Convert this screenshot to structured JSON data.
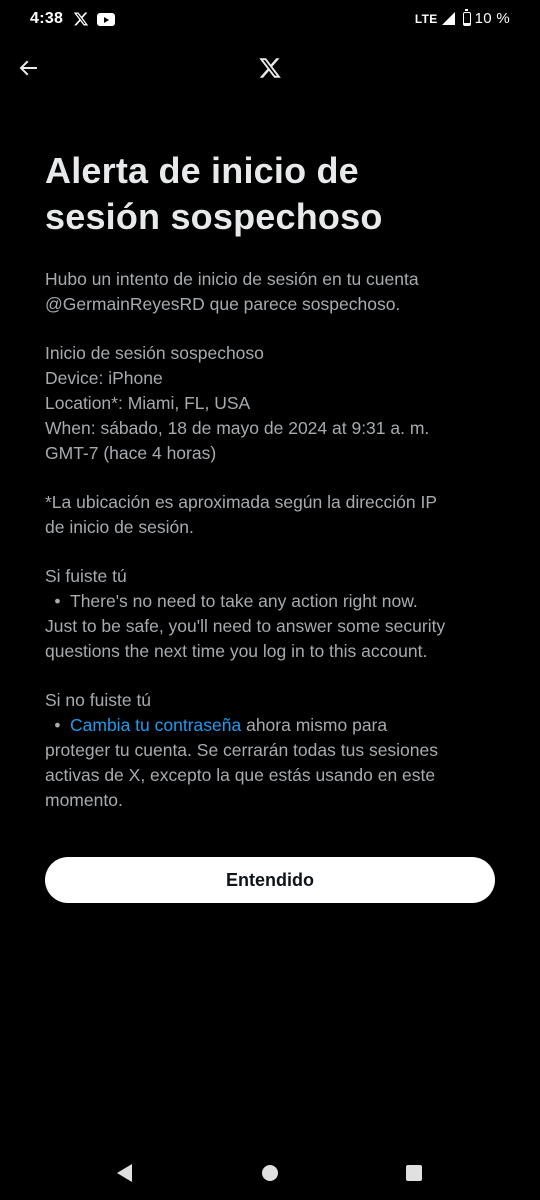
{
  "status_bar": {
    "time": "4:38",
    "network": "LTE",
    "battery_percent": "10 %",
    "battery_level": 0.1,
    "icons": [
      "x-app-icon",
      "youtube-icon",
      "signal-icon",
      "battery-icon"
    ]
  },
  "app_bar": {
    "back_icon": "arrow-left-icon",
    "logo": "x-logo-icon"
  },
  "alert": {
    "title_lines": [
      "Alerta de inicio de",
      "sesión sospechoso"
    ],
    "intro_lines": [
      "Hubo un intento de inicio de sesión en tu cuenta",
      "@GermainReyesRD que parece sospechoso."
    ],
    "details_lines": [
      "Inicio de sesión sospechoso",
      "Device: iPhone",
      "Location*: Miami, FL, USA",
      "When: sábado, 18 de mayo de 2024 at 9:31 a. m.",
      "GMT-7 (hace 4 horas)"
    ],
    "note_lines": [
      "*La ubicación es aproximada según la dirección IP",
      "de inicio de sesión."
    ],
    "if_you": {
      "heading": "Si fuiste tú",
      "bullet": "•",
      "line1": "There's no need to take any action right now.",
      "line2": "Just to be safe, you'll need to answer some security",
      "line3": "questions the next time you log in to this account."
    },
    "if_not_you": {
      "heading": "Si no fuiste tú",
      "bullet": "•",
      "link": "Cambia tu contraseña",
      "line1_rest": " ahora mismo para",
      "line2": "proteger tu cuenta. Se cerrarán todas tus sesiones",
      "line3": "activas de X, excepto la que estás usando en este",
      "line4": "momento."
    },
    "button_label": "Entendido"
  },
  "colors": {
    "background": "#000000",
    "title": "#e7e9ea",
    "body_text": "#a7abaf",
    "link": "#1d9bf0",
    "button_bg": "#ffffff",
    "button_text": "#0f1419"
  },
  "nav_bar": {
    "icons": [
      "nav-back-icon",
      "nav-home-icon",
      "nav-recents-icon"
    ]
  }
}
